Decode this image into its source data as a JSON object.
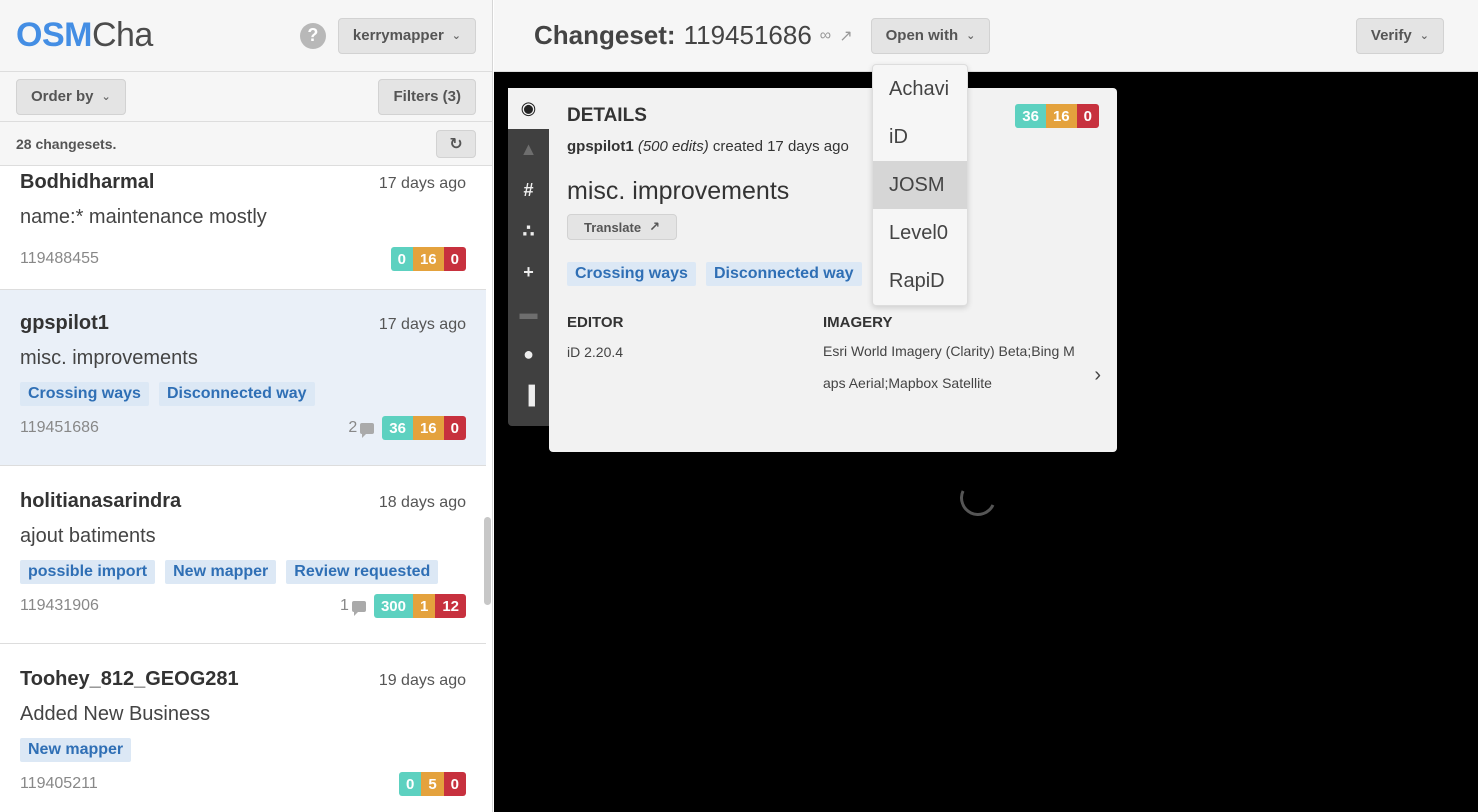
{
  "header": {
    "logo_osm": "OSM",
    "logo_cha": "Cha",
    "help_glyph": "?",
    "user_menu": "kerrymapper"
  },
  "toolbar": {
    "order_by": "Order by",
    "filters": "Filters (3)"
  },
  "count_text": "28 changesets.",
  "changesets": [
    {
      "user": "Bodhidharmal",
      "time": "17 days ago",
      "comment": "name:* maintenance mostly",
      "tags": [],
      "id": "119488455",
      "comments": "",
      "added": "0",
      "modified": "16",
      "deleted": "0"
    },
    {
      "user": "gpspilot1",
      "time": "17 days ago",
      "comment": "misc. improvements",
      "tags": [
        "Crossing ways",
        "Disconnected way"
      ],
      "id": "119451686",
      "comments": "2",
      "added": "36",
      "modified": "16",
      "deleted": "0"
    },
    {
      "user": "holitianasarindra",
      "time": "18 days ago",
      "comment": "ajout batiments",
      "tags": [
        "possible import",
        "New mapper",
        "Review requested"
      ],
      "id": "119431906",
      "comments": "1",
      "added": "300",
      "modified": "1",
      "deleted": "12"
    },
    {
      "user": "Toohey_812_GEOG281",
      "time": "19 days ago",
      "comment": "Added New Business",
      "tags": [
        "New mapper"
      ],
      "id": "119405211",
      "comments": "",
      "added": "0",
      "modified": "5",
      "deleted": "0"
    }
  ],
  "main": {
    "changeset_label": "Changeset:",
    "changeset_id": "119451686",
    "open_with": "Open with",
    "verify": "Verify"
  },
  "open_with_menu": [
    "Achavi",
    "iD",
    "JOSM",
    "Level0",
    "RapiD"
  ],
  "details": {
    "title": "DETAILS",
    "user": "gpspilot1",
    "edits": "(500 edits)",
    "created": "created 17 days ago",
    "comment": "misc. improvements",
    "translate": "Translate",
    "tags": [
      "Crossing ways",
      "Disconnected way"
    ],
    "editor_label": "EDITOR",
    "editor_value": "iD 2.20.4",
    "imagery_label": "IMAGERY",
    "imagery_value": "Esri World Imagery (Clarity) Beta;Bing Maps Aerial;Mapbox Satellite",
    "added": "36",
    "modified": "16",
    "deleted": "0"
  },
  "rail_icons": [
    "eye-icon",
    "warning-icon",
    "hashtag-icon",
    "features-icon",
    "plus-icon",
    "comment-icon",
    "user-icon",
    "map-icon"
  ],
  "colors": {
    "accent": "#448ee4",
    "added": "#5dd1c0",
    "modified": "#e4a23d",
    "deleted": "#c7313e",
    "tag_bg": "#dce8f5",
    "tag_text": "#2f6fb5"
  }
}
